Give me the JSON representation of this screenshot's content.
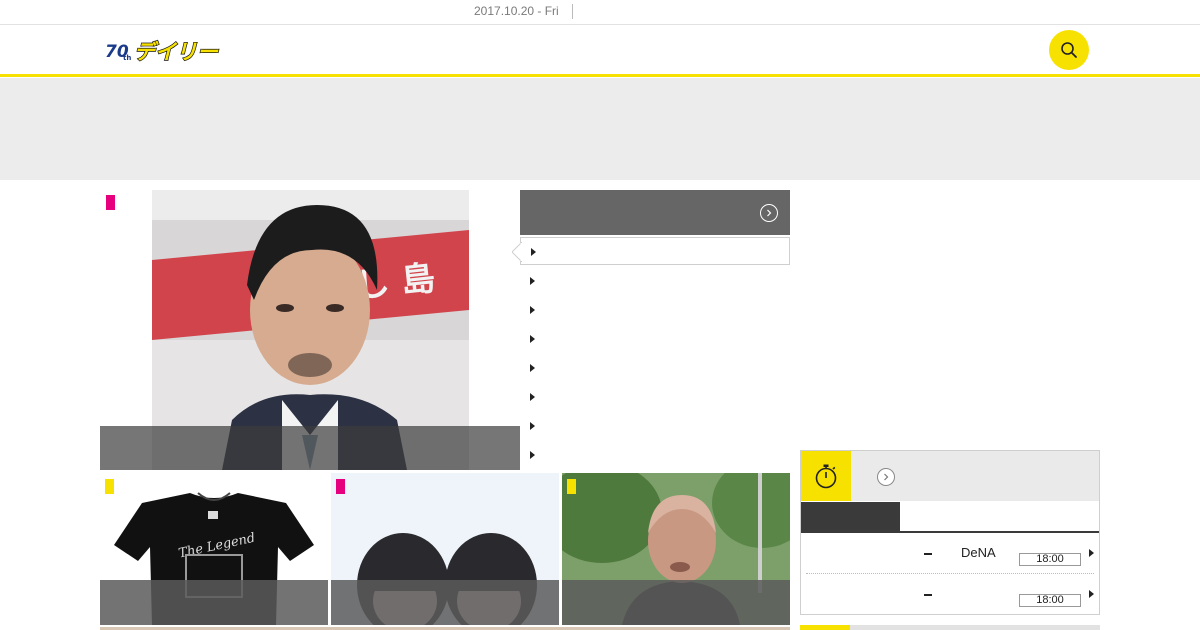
{
  "top_bar": {
    "date": "2017.10.20 - Fri"
  },
  "header": {
    "logo_text": "デイリー",
    "logo_anniv": "70th",
    "search_icon": "search-icon"
  },
  "colors": {
    "brand_yellow": "#f7e100",
    "entertainment_pink": "#e6007e",
    "sports_yellow": "#f7e100"
  },
  "main_story": {
    "category_color": "#e6007e",
    "title": ""
  },
  "news_list": {
    "header_title": "",
    "items": [
      {
        "title": ""
      },
      {
        "title": ""
      },
      {
        "title": ""
      },
      {
        "title": ""
      },
      {
        "title": ""
      },
      {
        "title": ""
      },
      {
        "title": ""
      },
      {
        "title": ""
      }
    ]
  },
  "thumbs": [
    {
      "category_color": "#f7e100",
      "title": ""
    },
    {
      "category_color": "#e6007e",
      "title": ""
    },
    {
      "category_color": "#f7e100",
      "title": ""
    }
  ],
  "scores_widget": {
    "icon": "stopwatch-icon",
    "title": "",
    "tab_label": "",
    "games": [
      {
        "home": "",
        "away": "DeNA",
        "time": "18:00"
      },
      {
        "home": "",
        "away": "",
        "time": "18:00"
      }
    ]
  }
}
